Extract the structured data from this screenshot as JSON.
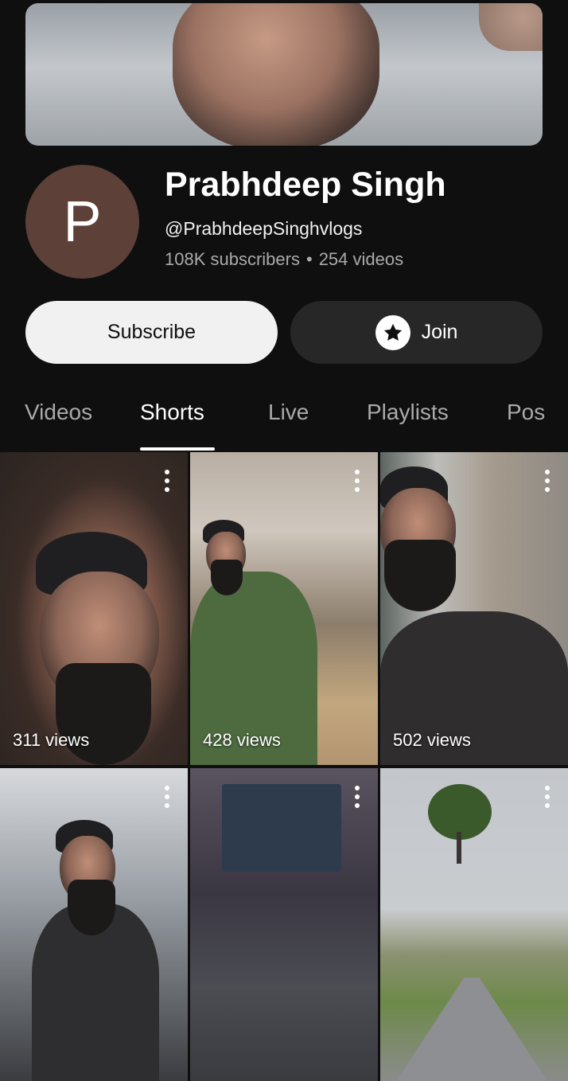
{
  "channel": {
    "avatar_letter": "P",
    "name": "Prabhdeep Singh",
    "handle": "@PrabhdeepSinghvlogs",
    "subscribers": "108K subscribers",
    "separator": "•",
    "videos": "254 videos",
    "avatar_color": "#5d4037"
  },
  "actions": {
    "subscribe_label": "Subscribe",
    "join_label": "Join",
    "join_icon": "star-icon"
  },
  "tabs": [
    {
      "label": "Videos",
      "active": false
    },
    {
      "label": "Shorts",
      "active": true
    },
    {
      "label": "Live",
      "active": false
    },
    {
      "label": "Playlists",
      "active": false
    },
    {
      "label": "Pos",
      "active": false
    }
  ],
  "shorts": [
    {
      "views": "311 views"
    },
    {
      "views": "428 views"
    },
    {
      "views": "502 views"
    },
    {
      "views": ""
    },
    {
      "views": ""
    },
    {
      "views": ""
    }
  ]
}
